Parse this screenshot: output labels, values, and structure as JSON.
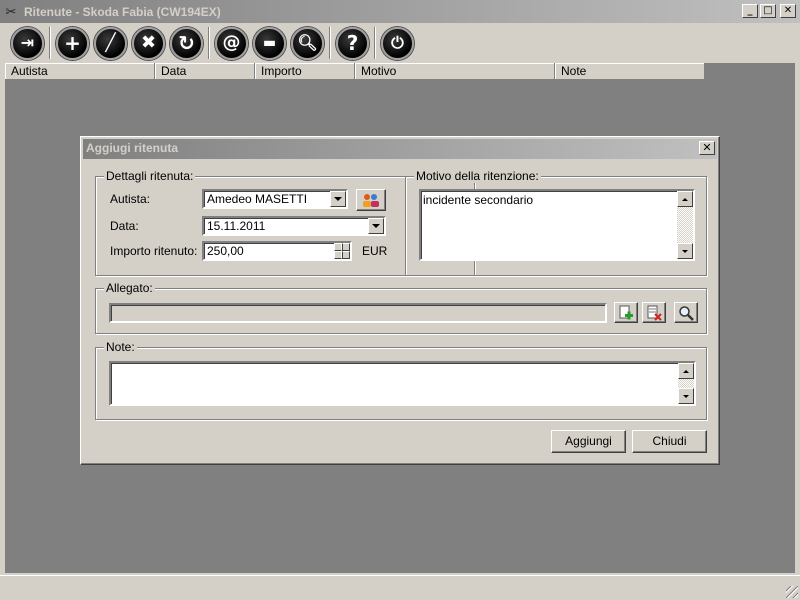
{
  "window": {
    "title": "Ritenute - Skoda Fabia (CW194EX)"
  },
  "list": {
    "columns": [
      {
        "label": "Autista"
      },
      {
        "label": "Data"
      },
      {
        "label": "Importo"
      },
      {
        "label": "Motivo"
      },
      {
        "label": "Note"
      }
    ]
  },
  "dialog": {
    "title": "Aggiugi ritenuta",
    "details": {
      "legend": "Dettagli ritenuta:",
      "autista_label": "Autista:",
      "autista_value": "Amedeo MASETTI",
      "data_label": "Data:",
      "data_value": "15.11.2011",
      "importo_label": "Importo ritenuto:",
      "importo_value": "250,00",
      "currency": "EUR"
    },
    "motivo": {
      "legend": "Motivo della ritenzione:",
      "value": "incidente secondario"
    },
    "allegato": {
      "legend": "Allegato:",
      "value": ""
    },
    "note": {
      "legend": "Note:",
      "value": ""
    },
    "buttons": {
      "add": "Aggiungi",
      "close": "Chiudi"
    }
  }
}
